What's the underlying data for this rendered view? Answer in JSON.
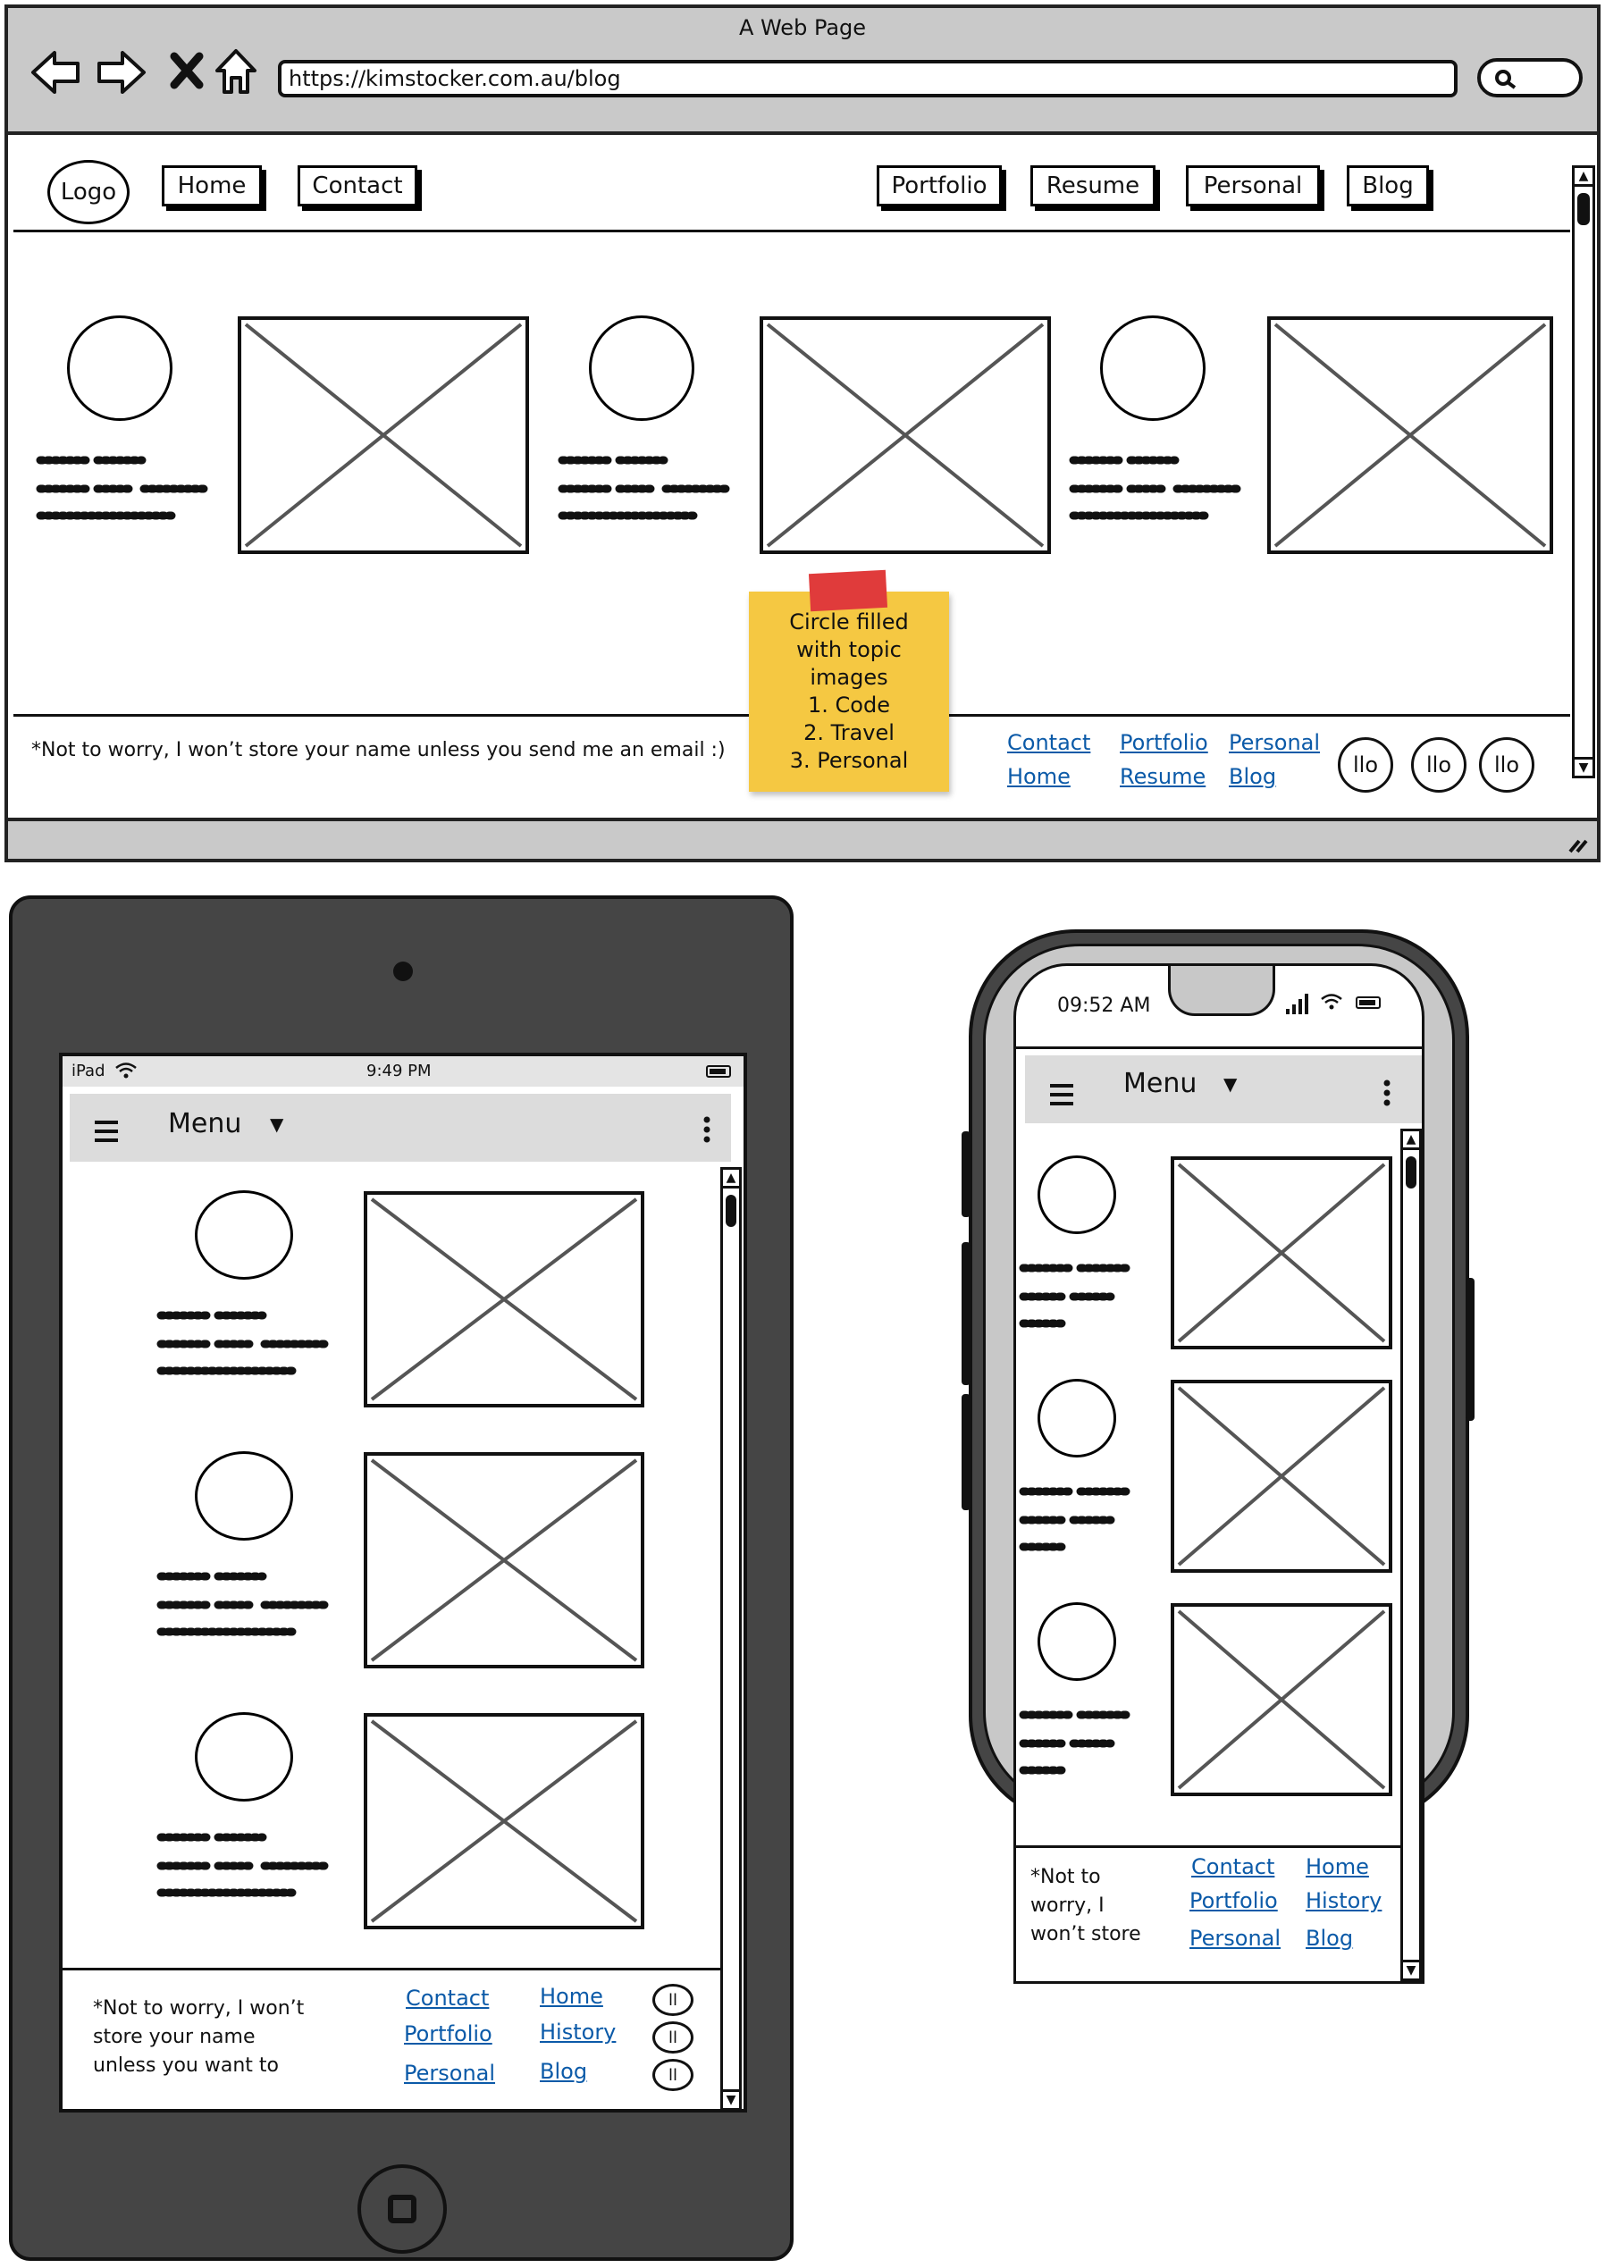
{
  "browser": {
    "title": "A Web Page",
    "url": "https://kimstocker.com.au/blog",
    "nav_left": [
      "Logo",
      "Home",
      "Contact"
    ],
    "nav_right": [
      "Portfolio",
      "Resume",
      "Personal",
      "Blog"
    ],
    "footer_note": "*Not to worry, I won’t store your name unless you send me an email :)",
    "footer_links": [
      "Contact",
      "Portfolio",
      "Personal",
      "Home",
      "Resume",
      "Blog"
    ],
    "social": [
      "llo",
      "llo",
      "llo"
    ]
  },
  "sticky_note": {
    "lines": [
      "Circle filled",
      "with topic",
      "images",
      "1. Code",
      "2. Travel",
      "3. Personal"
    ],
    "color": "#f5c842",
    "tape_color": "#e03b3b"
  },
  "tablet": {
    "carrier": "iPad",
    "time": "9:49 PM",
    "menu_label": "Menu",
    "footer_note": [
      "*Not to worry, I won’t",
      "store your name",
      "unless you want to"
    ],
    "links_col1": [
      "Contact",
      "Portfolio",
      "Personal"
    ],
    "links_col2": [
      "Home",
      "History",
      "Blog"
    ],
    "social": [
      "ll",
      "ll",
      "ll"
    ]
  },
  "phone": {
    "time": "09:52 AM",
    "menu_label": "Menu",
    "footer_note": [
      "*Not to",
      "worry, I",
      "won’t store"
    ],
    "links_col1": [
      "Contact",
      "Portfolio",
      "Personal"
    ],
    "links_col2": [
      "Home",
      "History",
      "Blog"
    ]
  },
  "colors": {
    "device_dark": "#454545",
    "phone_body": "#c8c8c8",
    "menu_bar": "#dcdcdc",
    "link": "#0b5aa8",
    "browser_chrome": "#c9c9c9"
  }
}
